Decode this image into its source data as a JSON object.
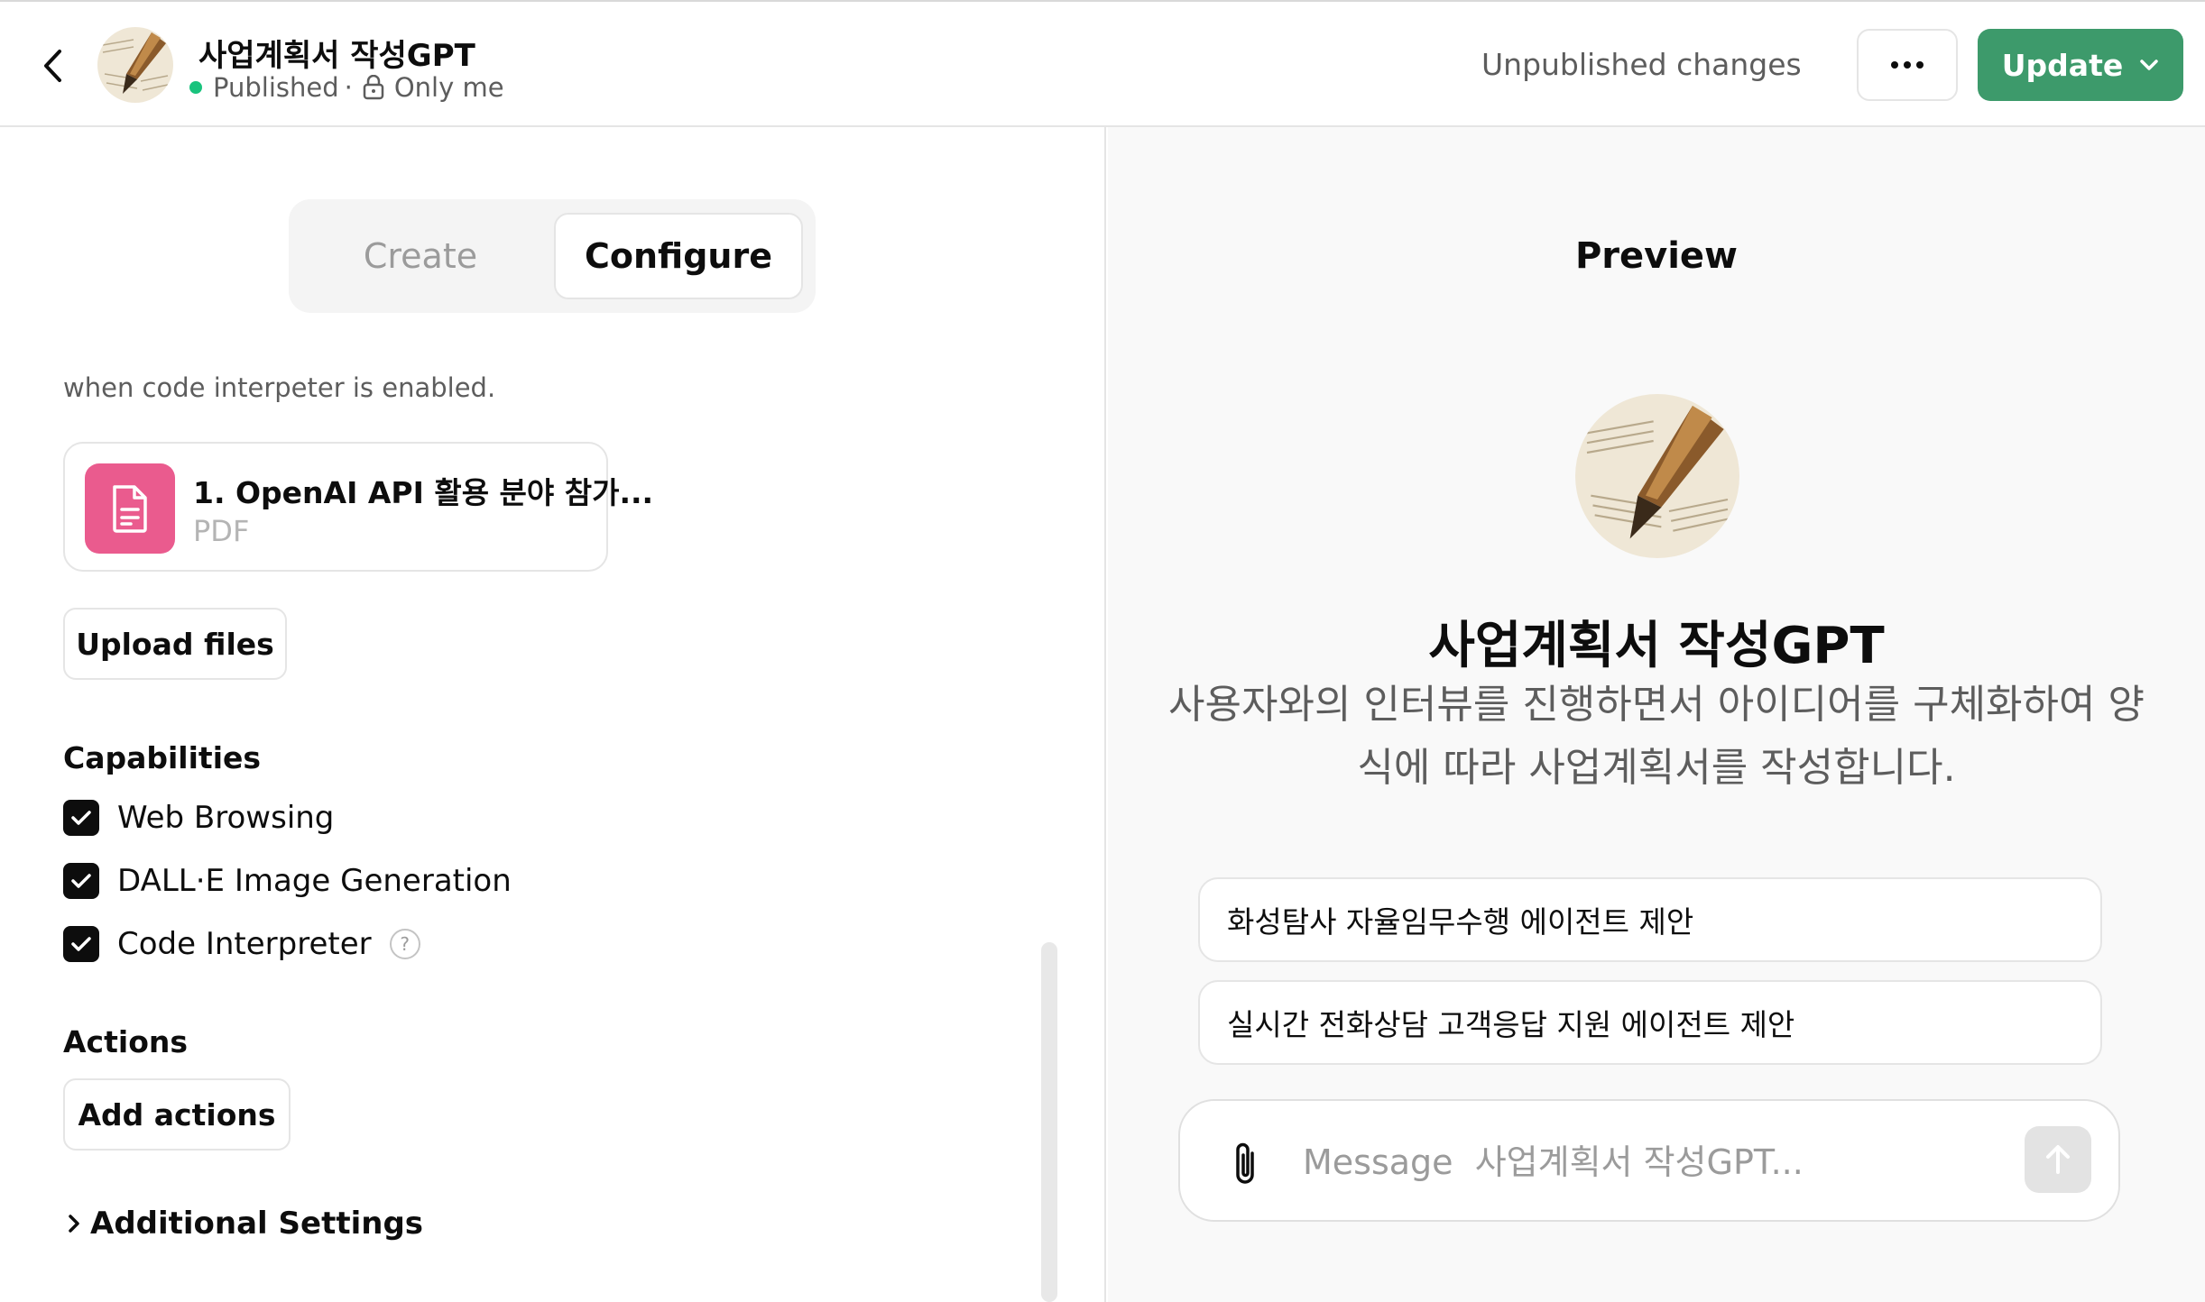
{
  "header": {
    "back_icon": "chevron-left-icon",
    "gpt_name": "사업계획서 작성GPT",
    "status": "Published",
    "status_sep": "·",
    "visibility": "Only me",
    "unpublished": "Unpublished changes",
    "more_icon": "more-horizontal-icon",
    "update_label": "Update",
    "update_color": "#3d9a6b"
  },
  "tabs": {
    "create": "Create",
    "configure": "Configure",
    "active": "Configure"
  },
  "knowledge": {
    "cutoff_text": "when code interpeter is enabled.",
    "file": {
      "name": "1. OpenAI API 활용 분야 참가...",
      "type": "PDF",
      "icon": "document-icon",
      "icon_color": "#ea5b8e"
    },
    "upload_label": "Upload files"
  },
  "capabilities": {
    "label": "Capabilities",
    "items": [
      {
        "label": "Web Browsing",
        "checked": true
      },
      {
        "label": "DALL·E Image Generation",
        "checked": true
      },
      {
        "label": "Code Interpreter",
        "checked": true,
        "help": "?"
      }
    ]
  },
  "actions": {
    "label": "Actions",
    "add_label": "Add actions"
  },
  "additional_settings": "Additional Settings",
  "preview": {
    "title": "Preview",
    "gpt_name": "사업계획서 작성GPT",
    "description": "사용자와의 인터뷰를 진행하면서 아이디어를 구체화하여 양식에 따라 사업계획서를 작성합니다.",
    "starters": [
      "화성탐사 자율임무수행 에이전트 제안",
      "실시간 전화상담 고객응답 지원 에이전트 제안"
    ],
    "composer_placeholder": "Message  사업계획서 작성GPT...",
    "attach_icon": "paperclip-icon",
    "send_icon": "arrow-up-icon"
  }
}
